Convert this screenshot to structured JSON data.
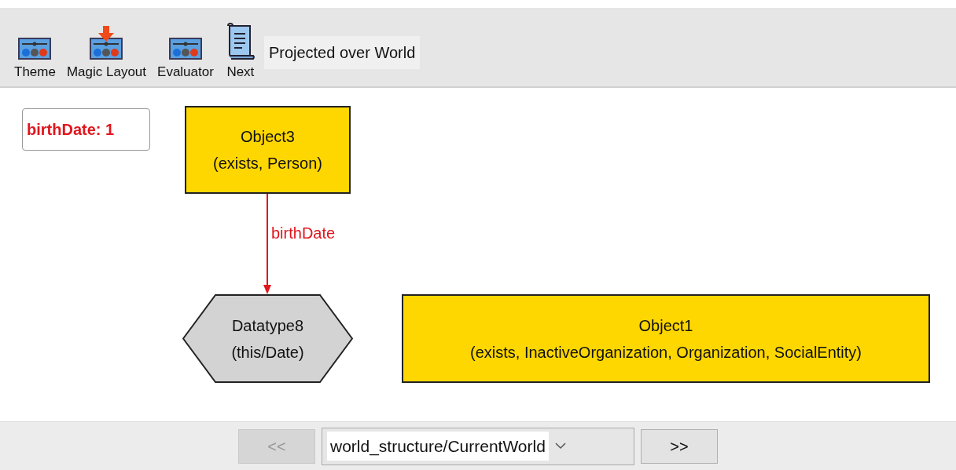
{
  "toolbar": {
    "buttons": [
      {
        "label": "Theme",
        "kind": "panel"
      },
      {
        "label": "Magic Layout",
        "kind": "panel-arrow"
      },
      {
        "label": "Evaluator",
        "kind": "panel"
      },
      {
        "label": "Next",
        "kind": "scroll"
      }
    ],
    "status": "Projected over World"
  },
  "legend": {
    "text": "birthDate: 1"
  },
  "diagram": {
    "nodes": [
      {
        "kind": "box",
        "title": "Object3",
        "types": "(exists, Person)"
      },
      {
        "kind": "hexagon",
        "title": "Datatype8",
        "types": "(this/Date)"
      },
      {
        "kind": "box",
        "title": "Object1",
        "types": "(exists, InactiveOrganization, Organization, SocialEntity)"
      }
    ],
    "edges": [
      {
        "label": "birthDate"
      }
    ]
  },
  "navigation": {
    "previous": {
      "label": "<<",
      "disabled": true
    },
    "world": "world_structure/CurrentWorld",
    "next": {
      "label": ">>",
      "disabled": false
    }
  }
}
